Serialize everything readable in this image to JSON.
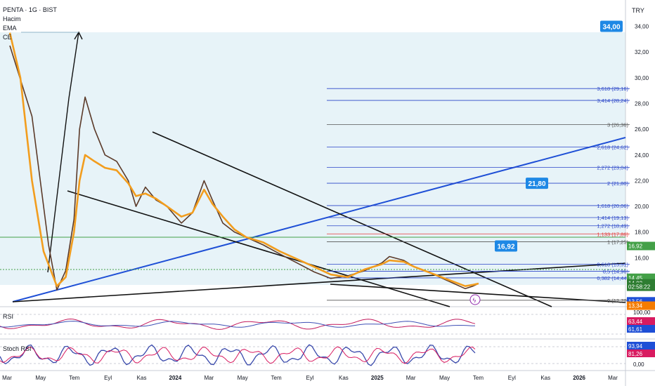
{
  "header": {
    "symbol_line": "PENTA · 1G · BIST",
    "indicators": [
      "Hacim",
      "EMA",
      "CE"
    ],
    "currency": "TRY"
  },
  "chart_data": {
    "type": "line",
    "title": "PENTA · 1G · BIST",
    "x_axis_labels": [
      "Mar",
      "May",
      "Tem",
      "Eyl",
      "Kas",
      "2024",
      "Mar",
      "May",
      "Tem",
      "Eyl",
      "Kas",
      "2025",
      "Mar",
      "May",
      "Tem",
      "Eyl",
      "Kas",
      "2026",
      "Mar"
    ],
    "price_axis_labels": [
      "34,00",
      "32,00",
      "30,00",
      "28,00",
      "26,00",
      "24,00",
      "22,00",
      "20,00",
      "18,00",
      "16,00",
      "14,00"
    ],
    "ylim": [
      12.2,
      35.5
    ],
    "log_scale": false,
    "series": [
      {
        "name": "",
        "color": "#5b3a29",
        "x": [
          "2023-03-01",
          "2023-04-10",
          "2023-05-10",
          "2023-05-25",
          "2023-06-10",
          "2023-06-25",
          "2023-07-05",
          "2023-07-15",
          "2023-08-01",
          "2023-08-20",
          "2023-09-10",
          "2023-10-01",
          "2023-10-15",
          "2023-11-01",
          "2023-11-20",
          "2023-12-10",
          "2024-01-05",
          "2024-01-25",
          "2024-02-15",
          "2024-03-01",
          "2024-03-20",
          "2024-04-10",
          "2024-05-01",
          "2024-06-01",
          "2024-07-01",
          "2024-08-01",
          "2024-09-01",
          "2024-10-01",
          "2024-11-01",
          "2024-12-01",
          "2025-01-01",
          "2025-01-15",
          "2025-02-10",
          "2025-03-01",
          "2025-04-01",
          "2025-05-01",
          "2025-06-01",
          "2025-06-15",
          "2025-06-25"
        ],
        "values": [
          32.5,
          27.0,
          17.0,
          13.5,
          15.0,
          19.0,
          26.0,
          28.5,
          26.0,
          24.0,
          23.5,
          22.0,
          20.0,
          21.5,
          20.5,
          20.0,
          18.7,
          19.5,
          22.0,
          20.5,
          18.7,
          18.0,
          17.6,
          17.0,
          16.3,
          15.6,
          14.9,
          14.4,
          14.6,
          15.0,
          15.6,
          16.1,
          15.8,
          15.3,
          14.8,
          14.2,
          13.6,
          13.8,
          14.0
        ]
      },
      {
        "name": "",
        "color": "#f29d1e",
        "x": [
          "2023-03-01",
          "2023-03-20",
          "2023-04-10",
          "2023-05-01",
          "2023-05-25",
          "2023-06-10",
          "2023-06-25",
          "2023-07-05",
          "2023-07-15",
          "2023-08-01",
          "2023-08-20",
          "2023-09-10",
          "2023-10-01",
          "2023-10-15",
          "2023-11-01",
          "2023-11-20",
          "2023-12-10",
          "2024-01-05",
          "2024-01-25",
          "2024-02-15",
          "2024-03-01",
          "2024-03-20",
          "2024-04-10",
          "2024-05-01",
          "2024-06-01",
          "2024-07-01",
          "2024-08-01",
          "2024-09-01",
          "2024-10-01",
          "2024-11-01",
          "2024-12-01",
          "2025-01-01",
          "2025-01-15",
          "2025-02-10",
          "2025-03-01",
          "2025-04-01",
          "2025-05-01",
          "2025-06-01",
          "2025-06-15",
          "2025-06-25"
        ],
        "values": [
          33.5,
          30.0,
          22.0,
          16.5,
          13.8,
          14.5,
          18.0,
          22.0,
          24.0,
          23.5,
          23.0,
          22.8,
          21.8,
          20.8,
          21.0,
          20.6,
          20.0,
          19.2,
          19.5,
          21.3,
          20.2,
          19.2,
          18.2,
          17.6,
          17.2,
          16.5,
          15.9,
          15.3,
          14.7,
          14.5,
          15.1,
          15.5,
          15.8,
          15.7,
          15.3,
          14.8,
          14.3,
          13.8,
          13.9,
          14.0
        ]
      }
    ],
    "markers": [
      {
        "label": "34,00",
        "value": 34.0
      },
      {
        "label": "21,80",
        "value": 21.8
      },
      {
        "label": "16,92",
        "value": 16.92
      }
    ],
    "fib_levels": [
      {
        "label": "3,618 (29,16)",
        "value": 29.16
      },
      {
        "label": "3,414 (28,24)",
        "value": 28.24
      },
      {
        "label": "3 (26,36)",
        "value": 26.36
      },
      {
        "label": "2,618 (24,62)",
        "value": 24.62
      },
      {
        "label": "2,272 (23,04)",
        "value": 23.04
      },
      {
        "label": "2 (21,80)",
        "value": 21.8
      },
      {
        "label": "1,618 (20,06)",
        "value": 20.06
      },
      {
        "label": "1,414 (19,13)",
        "value": 19.13
      },
      {
        "label": "1,272 (18,49)",
        "value": 18.49
      },
      {
        "label": "1,133 (17,86)",
        "value": 17.86
      },
      {
        "label": "1 (17,25)",
        "value": 17.25
      },
      {
        "label": "0,618 (15,51)",
        "value": 15.51
      },
      {
        "label": "0,5 (14,96)",
        "value": 14.96
      },
      {
        "label": "0,382 (14,44)",
        "value": 14.44
      },
      {
        "label": "0 (12,70)",
        "value": 12.7
      }
    ],
    "price_tags": [
      {
        "label": "16,92",
        "value": 16.92,
        "color": "#43a047"
      },
      {
        "label": "14,45",
        "value": 14.45,
        "color": "#43a047"
      },
      {
        "label": "14,02",
        "value": 14.02,
        "color": "#2e7d32"
      },
      {
        "label": "02:58:22",
        "value": 13.75,
        "color": "#2e7d32"
      },
      {
        "label": "13,56",
        "value": 12.62,
        "color": "#1e4fd6"
      },
      {
        "label": "13,34",
        "value": 12.28,
        "color": "#f57c00"
      }
    ],
    "rsi": {
      "label": "RSI",
      "axis_labels": [
        "100,00"
      ],
      "tags": [
        {
          "label": "63,44",
          "color": "#d81b60"
        },
        {
          "label": "61,61",
          "color": "#1e4fd6"
        }
      ]
    },
    "stoch_rsi": {
      "label": "Stoch RSI",
      "axis_labels": [
        "0,00"
      ],
      "tags": [
        {
          "label": "93,94",
          "color": "#1e4fd6"
        },
        {
          "label": "81,26",
          "color": "#d81b60"
        }
      ]
    }
  },
  "colors": {
    "background": "#ffffff",
    "cloud": "#d3eaf3",
    "fib_blue": "#2a45c8",
    "fib_red": "#e53935",
    "trend_blue": "#1e4fd6",
    "ema_orange": "#f29d1e",
    "ma_brown": "#5b3a29"
  }
}
